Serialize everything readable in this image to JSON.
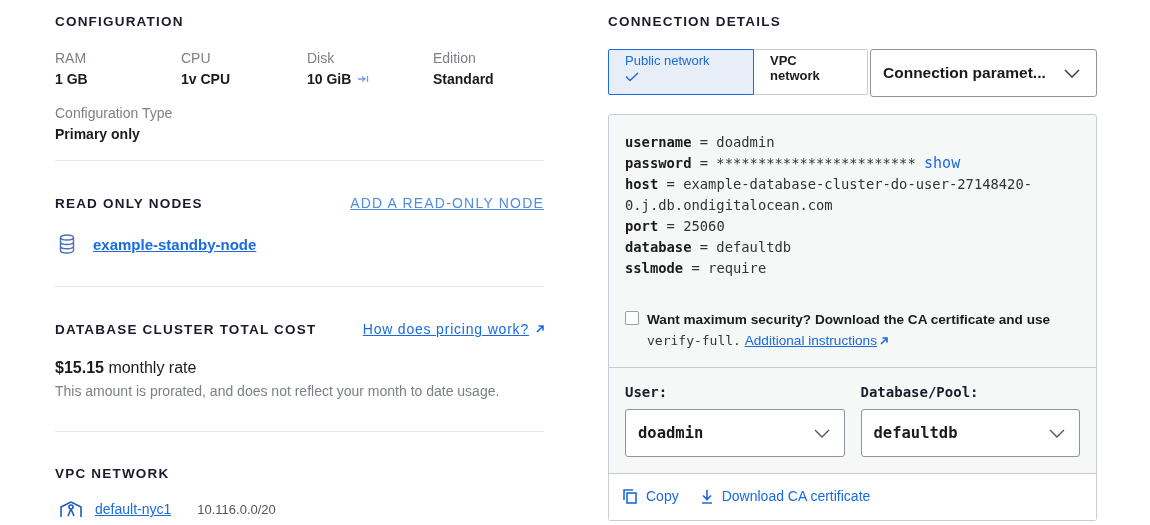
{
  "configuration": {
    "title": "CONFIGURATION",
    "specs": [
      {
        "label": "RAM",
        "value": "1 GB"
      },
      {
        "label": "CPU",
        "value": "1v CPU"
      },
      {
        "label": "Disk",
        "value": "10 GiB",
        "resize_icon": true
      },
      {
        "label": "Edition",
        "value": "Standard"
      }
    ],
    "type": {
      "label": "Configuration Type",
      "value": "Primary only"
    }
  },
  "read_only_nodes": {
    "title": "READ ONLY NODES",
    "add_link": "ADD A READ-ONLY NODE",
    "nodes": [
      {
        "name": "example-standby-node"
      }
    ]
  },
  "cost": {
    "title": "DATABASE CLUSTER TOTAL COST",
    "link": "How does pricing work?",
    "amount": "**$15.15** monthly rate",
    "note": "This amount is prorated, and does not reflect your month to date usage."
  },
  "vpc_network": {
    "title": "VPC NETWORK",
    "network": {
      "name": "default-nyc1",
      "cidr": "10.116.0.0/20"
    }
  },
  "connection": {
    "title": "CONNECTION DETAILS",
    "tabs": [
      {
        "label": "Public network",
        "selected": true
      },
      {
        "label": "VPC network",
        "selected": false
      }
    ],
    "format_select": {
      "value": "Connection paramet..."
    },
    "params": [
      {
        "key": "username",
        "sep": "=",
        "value": "doadmin"
      },
      {
        "key": "password",
        "sep": "=",
        "value": "************************",
        "action": "show"
      },
      {
        "key": "host",
        "sep": "=",
        "value": "example-database-cluster-do-user-27148420-0.j.db.ondigitalocean.com"
      },
      {
        "key": "port",
        "sep": "=",
        "value": "25060"
      },
      {
        "key": "database",
        "sep": "=",
        "value": "defaultdb"
      },
      {
        "key": "sslmode",
        "sep": "=",
        "value": "require"
      }
    ],
    "security": {
      "checked": false,
      "text": "Want maximum security? Download the CA certificate and use",
      "code": "verify-full.",
      "link": "Additional instructions"
    },
    "selects": [
      {
        "label": "User:",
        "value": "doadmin"
      },
      {
        "label": "Database/Pool:",
        "value": "defaultdb"
      }
    ],
    "actions": [
      {
        "kind": "copy",
        "label": "Copy"
      },
      {
        "kind": "download",
        "label": "Download CA certificate"
      }
    ]
  }
}
